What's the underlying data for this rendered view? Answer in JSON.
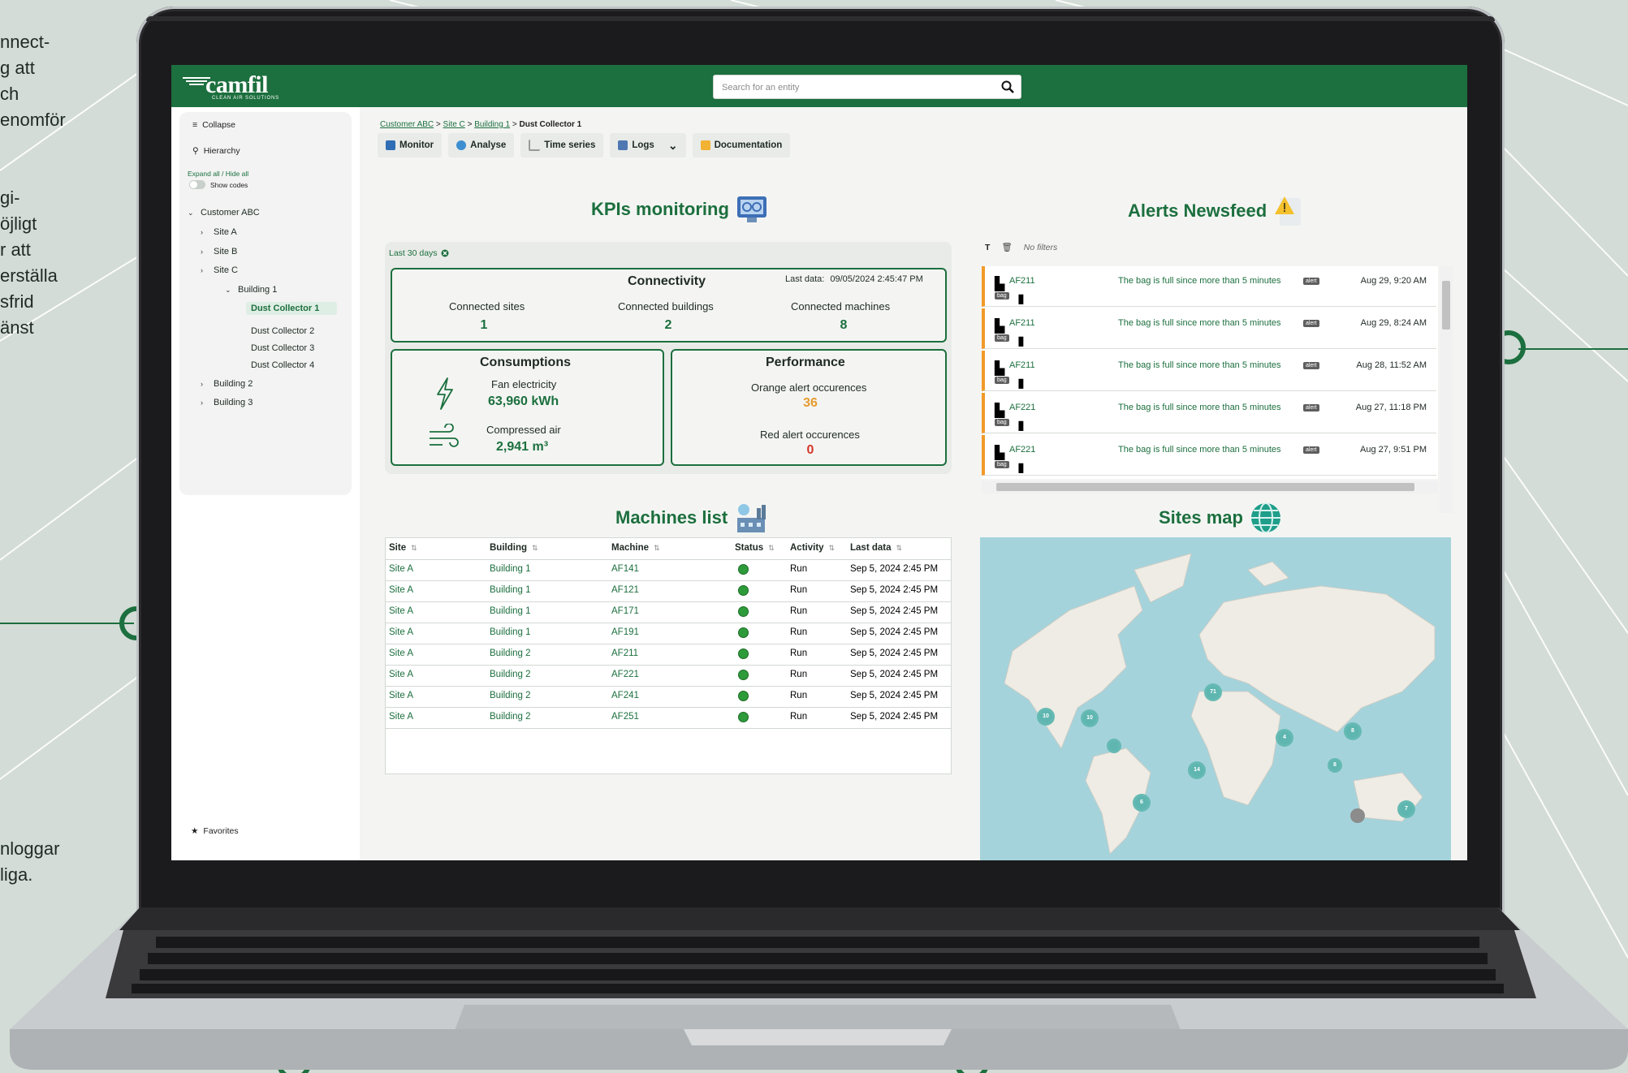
{
  "side_text": {
    "top_lines": [
      "nnect-",
      "g att",
      "ch",
      "enomför"
    ],
    "middle_lines": [
      "gi-",
      "öjligt",
      "r att",
      "erställa",
      "sfrid",
      "änst"
    ],
    "bottom_lines": [
      "nloggar",
      "liga."
    ]
  },
  "header": {
    "logo_text": "camfil",
    "logo_tagline": "CLEAN AIR SOLUTIONS",
    "search_placeholder": "Search for an entity"
  },
  "sidebar": {
    "collapse_label": "Collapse",
    "hierarchy_label": "Hierarchy",
    "expand_label": "Expand all / Hide all",
    "show_codes_label": "Show codes",
    "tree": {
      "customer": "Customer ABC",
      "site_a": "Site A",
      "site_b": "Site B",
      "site_c": "Site C",
      "building_1": "Building 1",
      "dc1": "Dust Collector 1",
      "dc2": "Dust Collector 2",
      "dc3": "Dust Collector 3",
      "dc4": "Dust Collector 4",
      "building_2": "Building 2",
      "building_3": "Building 3"
    },
    "favorites_label": "Favorites"
  },
  "breadcrumb": {
    "items": [
      "Customer ABC",
      "Site C",
      "Building 1"
    ],
    "current": "Dust Collector 1",
    "separator": ">"
  },
  "tabs": {
    "monitor": "Monitor",
    "analyse": "Analyse",
    "time_series": "Time series",
    "logs": "Logs",
    "documentation": "Documentation"
  },
  "kpi": {
    "title": "KPIs monitoring",
    "period": "Last 30 days",
    "connectivity": {
      "title": "Connectivity",
      "last_data_label": "Last data:",
      "last_data_value": "09/05/2024 2:45:47 PM",
      "sites_label": "Connected sites",
      "sites_value": "1",
      "buildings_label": "Connected buildings",
      "buildings_value": "2",
      "machines_label": "Connected machines",
      "machines_value": "8"
    },
    "consumptions": {
      "title": "Consumptions",
      "fan_label": "Fan electricity",
      "fan_value": "63,960 kWh",
      "air_label": "Compressed air",
      "air_value": "2,941 m³"
    },
    "performance": {
      "title": "Performance",
      "orange_label": "Orange alert occurences",
      "orange_value": "36",
      "red_label": "Red alert occurences",
      "red_value": "0"
    }
  },
  "alerts": {
    "title": "Alerts Newsfeed",
    "filter_text": "No filters",
    "tag_alert": "alert",
    "tag_bag": "bag",
    "items": [
      {
        "machine": "AF211",
        "message": "The bag is full since more than 5 minutes",
        "time": "Aug 29, 9:20 AM"
      },
      {
        "machine": "AF211",
        "message": "The bag is full since more than 5 minutes",
        "time": "Aug 29, 8:24 AM"
      },
      {
        "machine": "AF211",
        "message": "The bag is full since more than 5 minutes",
        "time": "Aug 28, 11:52 AM"
      },
      {
        "machine": "AF221",
        "message": "The bag is full since more than 5 minutes",
        "time": "Aug 27, 11:18 PM"
      },
      {
        "machine": "AF221",
        "message": "The bag is full since more than 5 minutes",
        "time": "Aug 27, 9:51 PM"
      }
    ]
  },
  "machines": {
    "title": "Machines list",
    "columns": [
      "Site",
      "Building",
      "Machine",
      "Status",
      "Activity",
      "Last data"
    ],
    "rows": [
      {
        "site": "Site A",
        "building": "Building 1",
        "machine": "AF141",
        "activity": "Run",
        "last_data": "Sep 5, 2024 2:45 PM"
      },
      {
        "site": "Site A",
        "building": "Building 1",
        "machine": "AF121",
        "activity": "Run",
        "last_data": "Sep 5, 2024 2:45 PM"
      },
      {
        "site": "Site A",
        "building": "Building 1",
        "machine": "AF171",
        "activity": "Run",
        "last_data": "Sep 5, 2024 2:45 PM"
      },
      {
        "site": "Site A",
        "building": "Building 1",
        "machine": "AF191",
        "activity": "Run",
        "last_data": "Sep 5, 2024 2:45 PM"
      },
      {
        "site": "Site A",
        "building": "Building 2",
        "machine": "AF211",
        "activity": "Run",
        "last_data": "Sep 5, 2024 2:45 PM"
      },
      {
        "site": "Site A",
        "building": "Building 2",
        "machine": "AF221",
        "activity": "Run",
        "last_data": "Sep 5, 2024 2:45 PM"
      },
      {
        "site": "Site A",
        "building": "Building 2",
        "machine": "AF241",
        "activity": "Run",
        "last_data": "Sep 5, 2024 2:45 PM"
      },
      {
        "site": "Site A",
        "building": "Building 2",
        "machine": "AF251",
        "activity": "Run",
        "last_data": "Sep 5, 2024 2:45 PM"
      }
    ]
  },
  "map": {
    "title": "Sites map",
    "clusters": [
      "10",
      "10",
      "71",
      "14",
      "4",
      "8",
      "8",
      "7",
      "6"
    ]
  },
  "colors": {
    "brand_green": "#1c6f3e",
    "alert_orange": "#f19a2a",
    "status_green": "#2e9b3a",
    "alert_red": "#d5362c"
  }
}
